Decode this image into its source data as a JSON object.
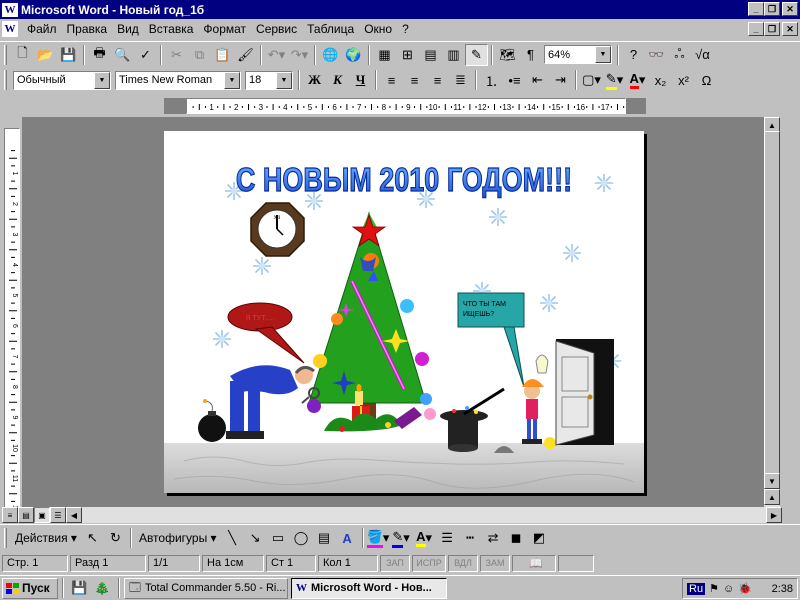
{
  "window": {
    "title": "Microsoft Word - Новый год_1б"
  },
  "menu": [
    "Файл",
    "Правка",
    "Вид",
    "Вставка",
    "Формат",
    "Сервис",
    "Таблица",
    "Окно",
    "?"
  ],
  "toolbar": {
    "zoom": "64%",
    "style": "Обычный",
    "font": "Times New Roman",
    "size": "18",
    "bold": "Ж",
    "italic": "К",
    "underline": "Ч"
  },
  "document": {
    "title_art": "С НОВЫМ 2010 ГОДОМ!!!",
    "bubble_left": "Я ТУТ.....",
    "bubble_right_line1": "ЧТО ТЫ ТАМ",
    "bubble_right_line2": "ИЩЕШЬ?",
    "ruler_numbers": [
      "1",
      "2",
      "3",
      "4",
      "5",
      "6",
      "7",
      "8",
      "9",
      "10",
      "11",
      "12",
      "13",
      "14",
      "15",
      "16",
      "17"
    ],
    "vruler_numbers": [
      "1",
      "2",
      "3",
      "4",
      "5",
      "6",
      "7",
      "8",
      "9",
      "10",
      "11",
      "12"
    ]
  },
  "drawing": {
    "actions": "Действия",
    "autoshapes": "Автофигуры"
  },
  "status": {
    "page": "Стр. 1",
    "section": "Разд 1",
    "pages": "1/1",
    "at": "На 1см",
    "line": "Ст 1",
    "col": "Кол 1",
    "rec": "ЗАП",
    "trk": "ИСПР",
    "ext": "ВДЛ",
    "ovr": "ЗАМ"
  },
  "taskbar": {
    "start": "Пуск",
    "items": [
      "Total Commander 5.50 - Ri...",
      "Microsoft Word - Нов..."
    ],
    "lang": "Ru",
    "time": "2:38"
  },
  "colors": {
    "title_bg": "#000080",
    "face": "#c0c0c0",
    "tree": "#22a01e",
    "star": "#e01010",
    "snow": "#9ec8ea"
  }
}
